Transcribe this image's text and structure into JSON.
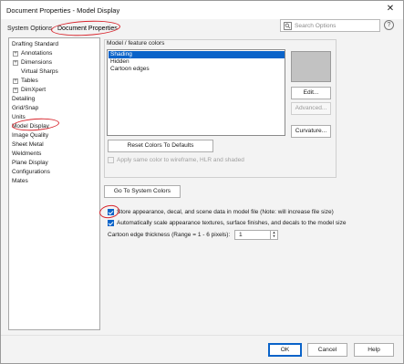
{
  "window": {
    "title": "Document Properties - Model Display",
    "close_glyph": "✕"
  },
  "tabs": {
    "system_options": "System Options",
    "document_properties": "Document Properties"
  },
  "search": {
    "placeholder": "Search Options",
    "help_glyph": "?"
  },
  "tree": {
    "items": [
      {
        "label": "Drafting Standard",
        "expander": ""
      },
      {
        "label": "Annotations",
        "expander": "+"
      },
      {
        "label": "Dimensions",
        "expander": "+"
      },
      {
        "label": "Virtual Sharps",
        "expander": ""
      },
      {
        "label": "Tables",
        "expander": "+"
      },
      {
        "label": "DimXpert",
        "expander": "+"
      },
      {
        "label": "Detailing",
        "expander": ""
      },
      {
        "label": "Grid/Snap",
        "expander": ""
      },
      {
        "label": "Units",
        "expander": ""
      },
      {
        "label": "Model Display",
        "expander": ""
      },
      {
        "label": "Image Quality",
        "expander": ""
      },
      {
        "label": "Sheet Metal",
        "expander": ""
      },
      {
        "label": "Weldments",
        "expander": ""
      },
      {
        "label": "Plane Display",
        "expander": ""
      },
      {
        "label": "Configurations",
        "expander": ""
      },
      {
        "label": "Mates",
        "expander": ""
      }
    ]
  },
  "colors_group": {
    "title": "Model / feature colors",
    "items": [
      "Shading",
      "Hidden",
      "Cartoon edges"
    ],
    "selected": "Shading",
    "swatch_color": "#c2c2c2",
    "edit_label": "Edit...",
    "advanced_label": "Advanced...",
    "curvature_label": "Curvature...",
    "reset_label": "Reset Colors To Defaults",
    "apply_same_color_label": "Apply same color to wireframe, HLR and shaded"
  },
  "go_to_system_colors": "Go To System Colors",
  "options": {
    "store_appearance_label": "Store appearance, decal, and scene data in model file (Note: will increase file size)",
    "store_appearance_checked": true,
    "auto_scale_label": "Automatically scale appearance textures, surface finishes, and decals to the model size",
    "auto_scale_checked": true,
    "cartoon_edge_label": "Cartoon edge thickness (Range = 1 - 6 pixels):",
    "cartoon_edge_value": "1",
    "spin_up_glyph": "▲",
    "spin_down_glyph": "▼"
  },
  "footer": {
    "ok": "OK",
    "cancel": "Cancel",
    "help": "Help"
  },
  "colors": {
    "accent": "#0a63c9",
    "annotation_red": "#d8262e"
  }
}
